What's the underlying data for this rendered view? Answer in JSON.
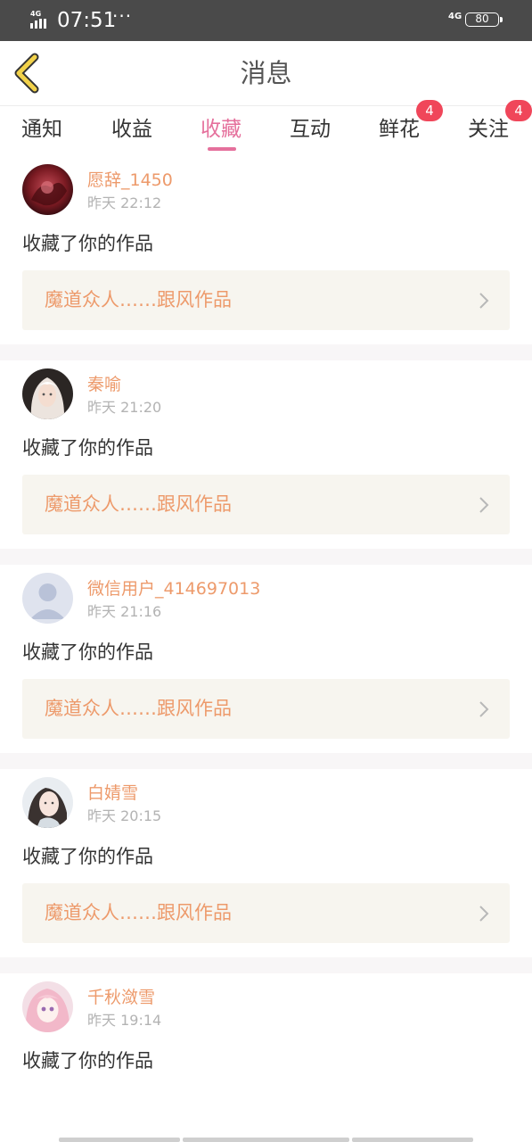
{
  "status_bar": {
    "network_left": "4G",
    "time": "07:51",
    "dots": "···",
    "network_right": "4G",
    "battery": "80"
  },
  "header": {
    "title": "消息"
  },
  "tabs": [
    {
      "label": "通知"
    },
    {
      "label": "收益"
    },
    {
      "label": "收藏",
      "active": true
    },
    {
      "label": "互动"
    },
    {
      "label": "鲜花",
      "badge": "4"
    },
    {
      "label": "关注",
      "badge": "4"
    }
  ],
  "feed": [
    {
      "username": "愿辞_1450",
      "time": "昨天 22:12",
      "action": "收藏了你的作品",
      "work_title": "魔道众人……跟风作品",
      "avatar": "dark-red-artwork"
    },
    {
      "username": "秦喻",
      "time": "昨天 21:20",
      "action": "收藏了你的作品",
      "work_title": "魔道众人……跟风作品",
      "avatar": "pale-hair-character"
    },
    {
      "username": "微信用户_414697013",
      "time": "昨天 21:16",
      "action": "收藏了你的作品",
      "work_title": "魔道众人……跟风作品",
      "avatar": "default-user"
    },
    {
      "username": "白婧雪",
      "time": "昨天 20:15",
      "action": "收藏了你的作品",
      "work_title": "魔道众人……跟风作品",
      "avatar": "girl-photo"
    },
    {
      "username": "千秋潋雪",
      "time": "昨天 19:14",
      "action": "收藏了你的作品",
      "work_title": "",
      "avatar": "anime-girl-pink"
    }
  ],
  "colors": {
    "accent": "#e5709c",
    "username": "#ed9a6b",
    "badge": "#f0465a",
    "work_box": "#f7f5ef"
  }
}
